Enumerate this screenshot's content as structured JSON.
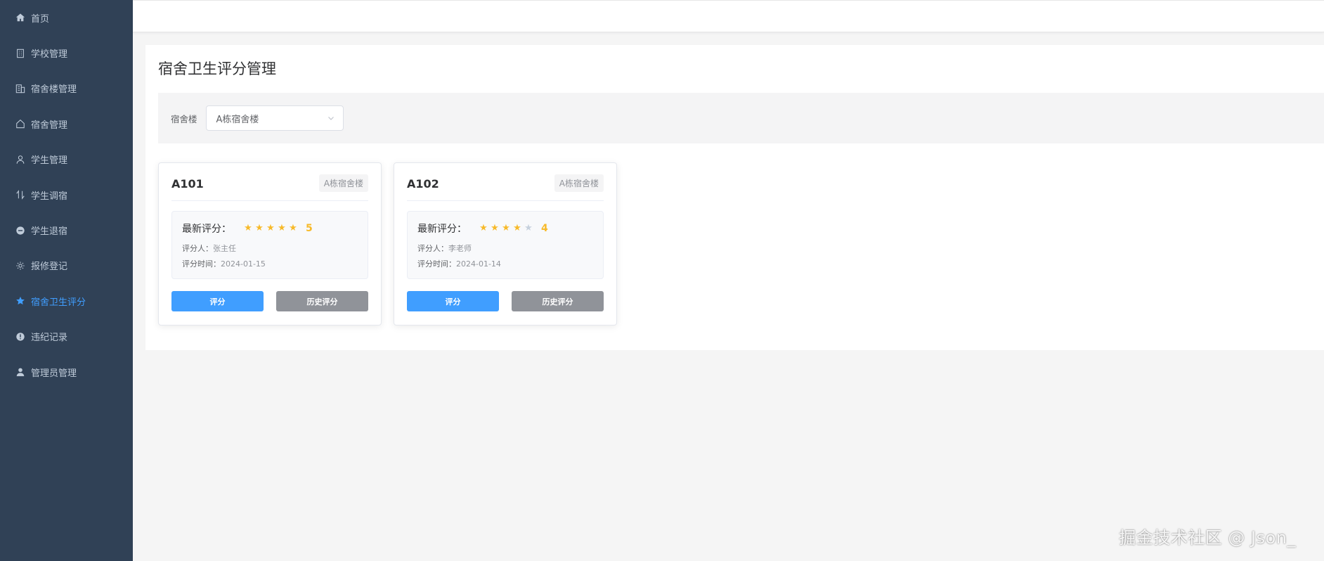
{
  "sidebar": {
    "items": [
      {
        "label": "首页",
        "icon": "home-icon"
      },
      {
        "label": "学校管理",
        "icon": "building-icon"
      },
      {
        "label": "宿舍楼管理",
        "icon": "office-building-icon"
      },
      {
        "label": "宿舍管理",
        "icon": "house-icon"
      },
      {
        "label": "学生管理",
        "icon": "user-icon"
      },
      {
        "label": "学生调宿",
        "icon": "switch-icon"
      },
      {
        "label": "学生退宿",
        "icon": "remove-icon"
      },
      {
        "label": "报修登记",
        "icon": "setting-icon"
      },
      {
        "label": "宿舍卫生评分",
        "icon": "star-icon",
        "active": true
      },
      {
        "label": "违纪记录",
        "icon": "warning-icon"
      },
      {
        "label": "管理员管理",
        "icon": "admin-user-icon"
      }
    ],
    "colors": {
      "background": "#304156",
      "text": "#bfcbd9",
      "active": "#409eff"
    }
  },
  "page": {
    "title": "宿舍卫生评分管理"
  },
  "filter": {
    "label": "宿舍楼",
    "selected": "A栋宿舍楼"
  },
  "cards": [
    {
      "room": "A101",
      "building": "A栋宿舍楼",
      "score_label": "最新评分：",
      "rating": 5,
      "score": "5",
      "rater_label": "评分人：",
      "rater": "张主任",
      "time_label": "评分时间：",
      "time": "2024-01-15",
      "rate_button": "评分",
      "history_button": "历史评分"
    },
    {
      "room": "A102",
      "building": "A栋宿舍楼",
      "score_label": "最新评分：",
      "rating": 4,
      "score": "4",
      "rater_label": "评分人：",
      "rater": "李老师",
      "time_label": "评分时间：",
      "time": "2024-01-14",
      "rate_button": "评分",
      "history_button": "历史评分"
    }
  ],
  "watermark": "掘金技术社区 @ Json_",
  "colors": {
    "primary": "#409eff",
    "secondary": "#909399",
    "star": "#f7ba2a"
  }
}
